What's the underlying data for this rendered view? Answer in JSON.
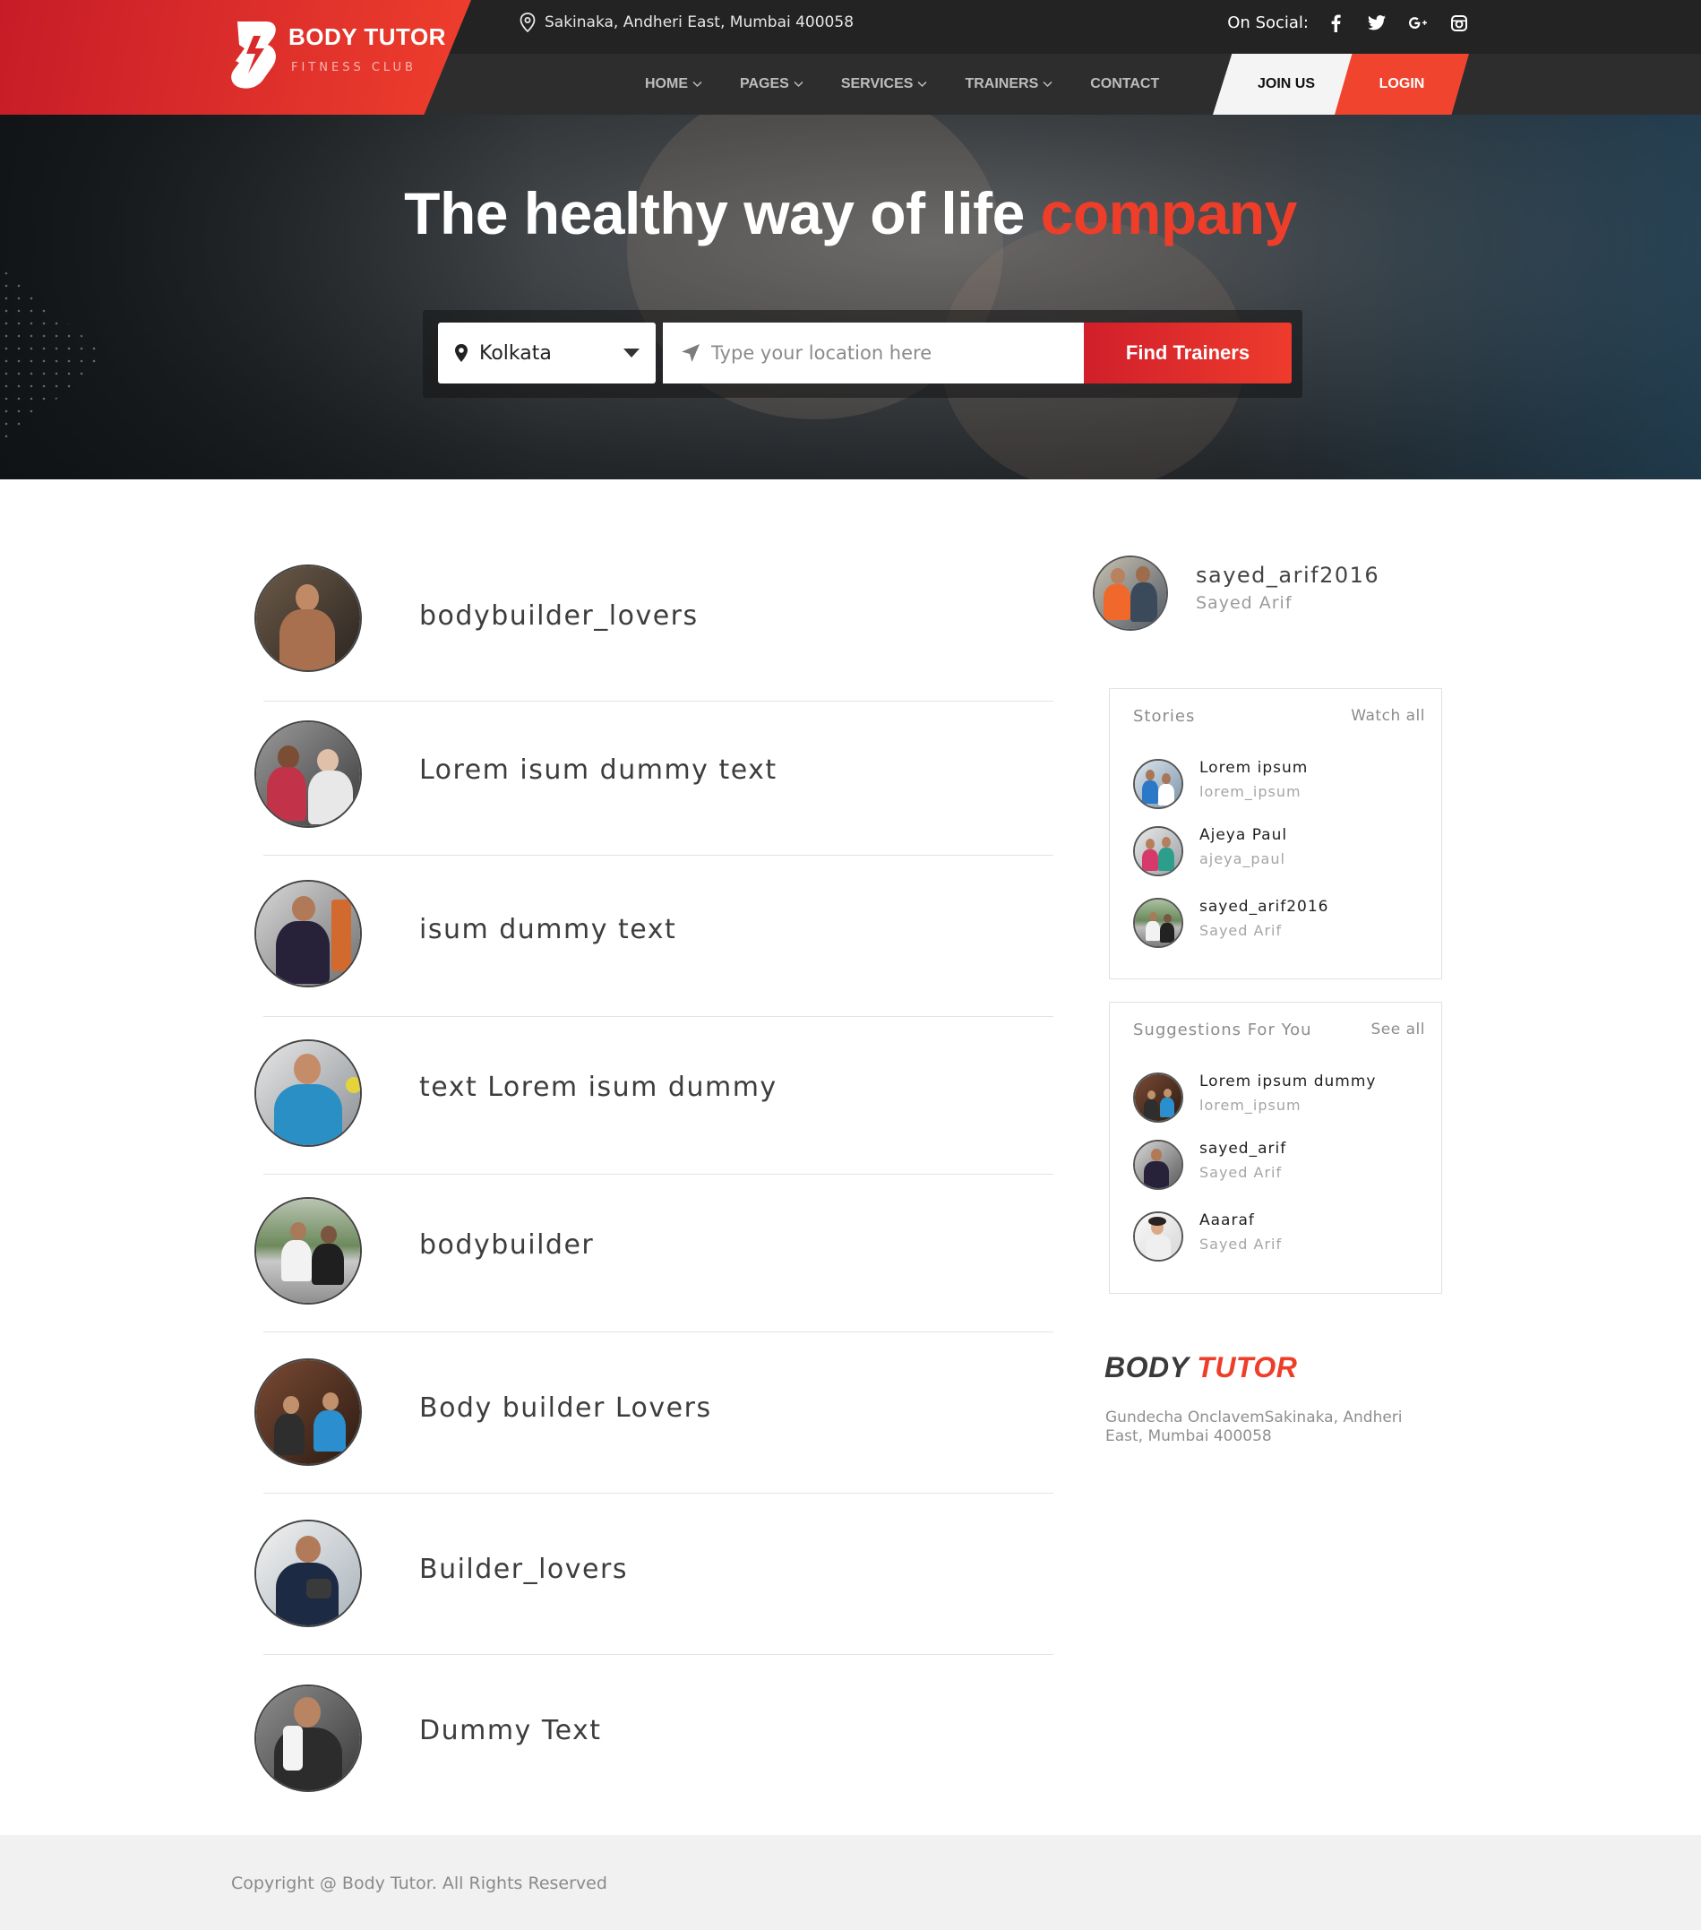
{
  "header": {
    "logo_title": "BODY TUTOR",
    "logo_subtitle": "FITNESS CLUB",
    "address": "Sakinaka, Andheri East, Mumbai 400058",
    "social_label": "On Social:",
    "social_icons": [
      "facebook-icon",
      "twitter-icon",
      "google-plus-icon",
      "instagram-icon"
    ],
    "menu": [
      {
        "label": "HOME",
        "has_dropdown": true
      },
      {
        "label": "PAGES",
        "has_dropdown": true
      },
      {
        "label": "SERVICES",
        "has_dropdown": true
      },
      {
        "label": "TRAINERS",
        "has_dropdown": true
      },
      {
        "label": "CONTACT",
        "has_dropdown": false
      }
    ],
    "join_label": "JOIN US",
    "login_label": "LOGIN"
  },
  "hero": {
    "title_main": "The healthy way of life ",
    "title_accent": "company",
    "city_value": "Kolkata",
    "location_placeholder": "Type your location here",
    "find_button": "Find Trainers"
  },
  "feed": {
    "items": [
      {
        "name": "bodybuilder_lovers"
      },
      {
        "name": "Lorem isum dummy text"
      },
      {
        "name": "isum dummy text"
      },
      {
        "name": " text Lorem isum dummy"
      },
      {
        "name": "bodybuilder"
      },
      {
        "name": "Body builder Lovers"
      },
      {
        "name": "Builder_lovers"
      },
      {
        "name": " Dummy Text"
      }
    ]
  },
  "sidebar": {
    "profile": {
      "username": "sayed_arif2016",
      "name": "Sayed Arif"
    },
    "stories": {
      "title": "Stories",
      "link": "Watch all",
      "items": [
        {
          "title": "Lorem ipsum",
          "subtitle": "lorem_ipsum"
        },
        {
          "title": "Ajeya Paul",
          "subtitle": "ajeya_paul"
        },
        {
          "title": "sayed_arif2016",
          "subtitle": "Sayed Arif"
        }
      ]
    },
    "suggestions": {
      "title": "Suggestions For You",
      "link": "See all",
      "items": [
        {
          "title": "Lorem ipsum dummy",
          "subtitle": "lorem_ipsum"
        },
        {
          "title": "sayed_arif",
          "subtitle": "Sayed Arif"
        },
        {
          "title": "Aaaraf",
          "subtitle": "Sayed Arif"
        }
      ]
    },
    "brand": {
      "main": "BODY ",
      "accent": "TUTOR"
    },
    "brand_address": "Gundecha OnclavemSakinaka, Andheri East, Mumbai 400058"
  },
  "footer": {
    "copyright": "Copyright @ Body Tutor. All Rights Reserved"
  },
  "colors": {
    "accent": "#ee3e2a",
    "header_dark": "#232323",
    "nav_dark": "#2d2d2d",
    "footer_bg": "#f2f1f1"
  }
}
